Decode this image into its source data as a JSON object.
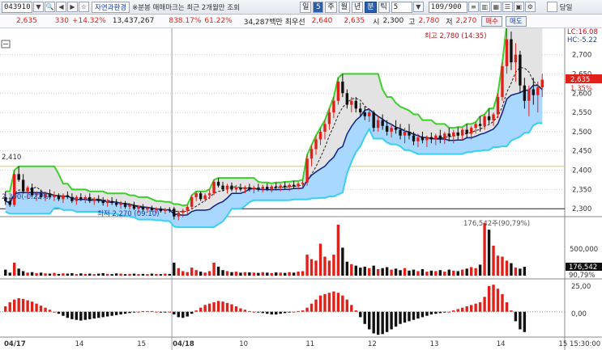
{
  "toolbar": {
    "code": "043910",
    "search_icon": "search-icon",
    "stock_name": "자연과환경",
    "notice": "※분봉 매매마크는 최근 2개월만 조회",
    "periods": [
      "일",
      "5",
      "주",
      "월",
      "년",
      "분",
      "틱"
    ],
    "active_period": "분",
    "interval_value": "5",
    "count_value": "109/900",
    "sameday_label": "당일"
  },
  "quote": {
    "price": "2,635",
    "change": "330",
    "change_pct": "+14.32%",
    "volume": "13,437,267",
    "volume_ratio": "838.17%",
    "turnover": "61.22%",
    "amount": "34,287백만",
    "best_bid_label": "최우선",
    "bid": "2,640",
    "ask": "2,635",
    "open_label": "시",
    "open": "2,300",
    "high_label": "고",
    "high": "2,780",
    "low_label": "저",
    "low": "2,270",
    "buy_label": "매수",
    "sell_label": "매도"
  },
  "colors": {
    "up": "#e0211a",
    "down": "#111111",
    "upper_band": "#3bd12a",
    "lower_band": "#0d1f8a",
    "cloud_light": "#a8d7ff",
    "cloud_dark": "#74b6f2",
    "grid": "#c9ced6",
    "current_price_box": "#e0211a"
  },
  "chart_data": {
    "type": "candlestick",
    "price_axis": {
      "ticks": [
        "2,700",
        "2,650",
        "2,600",
        "2,550",
        "2,500",
        "2,450",
        "2,400",
        "2,350",
        "2,300"
      ],
      "tick_values": [
        2700,
        2650,
        2600,
        2550,
        2500,
        2450,
        2400,
        2350,
        2300
      ],
      "ylim": [
        2290,
        2760
      ],
      "lc_label": "LC:16.08",
      "hc_label": "HC:-5.22",
      "current_price": "2,635",
      "current_pct": "1.35%",
      "left_level": "2,410",
      "prev_close_label": "2,300(-0.22%)"
    },
    "annotations": {
      "high_label": "최고 2,780 (14:35)",
      "low_label": "최저 2,270 (09:10)"
    },
    "time_axis": {
      "labels": [
        "04/17",
        "14",
        "15",
        "04/18",
        "10",
        "11",
        "12",
        "13",
        "14",
        "15",
        "15:30:00"
      ],
      "positions": [
        0,
        16,
        30,
        38,
        53,
        68,
        82,
        96,
        111,
        125,
        133
      ]
    },
    "day_divider_index": 38,
    "candles": [
      [
        2330,
        2345,
        2310,
        2320
      ],
      [
        2320,
        2330,
        2305,
        2310
      ],
      [
        2310,
        2400,
        2305,
        2390
      ],
      [
        2390,
        2410,
        2370,
        2375
      ],
      [
        2375,
        2390,
        2340,
        2345
      ],
      [
        2345,
        2360,
        2325,
        2355
      ],
      [
        2355,
        2365,
        2330,
        2335
      ],
      [
        2335,
        2345,
        2320,
        2340
      ],
      [
        2340,
        2350,
        2325,
        2330
      ],
      [
        2330,
        2345,
        2320,
        2340
      ],
      [
        2340,
        2350,
        2325,
        2330
      ],
      [
        2330,
        2345,
        2320,
        2335
      ],
      [
        2335,
        2340,
        2320,
        2325
      ],
      [
        2325,
        2340,
        2315,
        2335
      ],
      [
        2335,
        2345,
        2325,
        2330
      ],
      [
        2330,
        2340,
        2315,
        2320
      ],
      [
        2320,
        2335,
        2310,
        2330
      ],
      [
        2330,
        2340,
        2320,
        2325
      ],
      [
        2325,
        2335,
        2315,
        2330
      ],
      [
        2330,
        2340,
        2315,
        2320
      ],
      [
        2320,
        2330,
        2310,
        2325
      ],
      [
        2325,
        2335,
        2315,
        2320
      ],
      [
        2320,
        2330,
        2308,
        2315
      ],
      [
        2315,
        2325,
        2305,
        2320
      ],
      [
        2320,
        2330,
        2310,
        2315
      ],
      [
        2315,
        2325,
        2305,
        2310
      ],
      [
        2310,
        2320,
        2300,
        2315
      ],
      [
        2315,
        2320,
        2300,
        2305
      ],
      [
        2305,
        2315,
        2298,
        2310
      ],
      [
        2310,
        2318,
        2296,
        2300
      ],
      [
        2300,
        2310,
        2290,
        2305
      ],
      [
        2305,
        2312,
        2293,
        2298
      ],
      [
        2298,
        2306,
        2290,
        2302
      ],
      [
        2302,
        2308,
        2292,
        2296
      ],
      [
        2296,
        2304,
        2288,
        2300
      ],
      [
        2300,
        2306,
        2290,
        2294
      ],
      [
        2294,
        2302,
        2286,
        2298
      ],
      [
        2298,
        2304,
        2290,
        2295
      ],
      [
        2300,
        2305,
        2272,
        2280
      ],
      [
        2280,
        2295,
        2270,
        2290
      ],
      [
        2290,
        2300,
        2278,
        2295
      ],
      [
        2295,
        2310,
        2285,
        2305
      ],
      [
        2305,
        2335,
        2300,
        2330
      ],
      [
        2330,
        2345,
        2320,
        2340
      ],
      [
        2340,
        2345,
        2320,
        2325
      ],
      [
        2325,
        2340,
        2318,
        2335
      ],
      [
        2335,
        2350,
        2325,
        2340
      ],
      [
        2340,
        2375,
        2335,
        2370
      ],
      [
        2370,
        2380,
        2355,
        2360
      ],
      [
        2360,
        2370,
        2345,
        2350
      ],
      [
        2350,
        2365,
        2340,
        2360
      ],
      [
        2360,
        2368,
        2345,
        2350
      ],
      [
        2350,
        2362,
        2342,
        2355
      ],
      [
        2355,
        2365,
        2345,
        2350
      ],
      [
        2350,
        2360,
        2340,
        2356
      ],
      [
        2356,
        2365,
        2345,
        2350
      ],
      [
        2350,
        2360,
        2340,
        2355
      ],
      [
        2355,
        2365,
        2345,
        2352
      ],
      [
        2352,
        2362,
        2342,
        2357
      ],
      [
        2357,
        2366,
        2346,
        2350
      ],
      [
        2350,
        2362,
        2342,
        2358
      ],
      [
        2358,
        2368,
        2348,
        2355
      ],
      [
        2355,
        2365,
        2345,
        2360
      ],
      [
        2360,
        2370,
        2350,
        2356
      ],
      [
        2356,
        2366,
        2346,
        2362
      ],
      [
        2362,
        2372,
        2352,
        2358
      ],
      [
        2358,
        2370,
        2350,
        2365
      ],
      [
        2365,
        2375,
        2355,
        2368
      ],
      [
        2368,
        2440,
        2360,
        2430
      ],
      [
        2430,
        2465,
        2410,
        2455
      ],
      [
        2455,
        2490,
        2440,
        2480
      ],
      [
        2480,
        2510,
        2465,
        2500
      ],
      [
        2500,
        2530,
        2480,
        2520
      ],
      [
        2520,
        2560,
        2505,
        2550
      ],
      [
        2550,
        2590,
        2535,
        2580
      ],
      [
        2580,
        2640,
        2570,
        2630
      ],
      [
        2630,
        2650,
        2590,
        2600
      ],
      [
        2600,
        2610,
        2560,
        2570
      ],
      [
        2570,
        2590,
        2550,
        2580
      ],
      [
        2580,
        2590,
        2550,
        2560
      ],
      [
        2560,
        2575,
        2540,
        2550
      ],
      [
        2550,
        2565,
        2530,
        2540
      ],
      [
        2540,
        2560,
        2525,
        2550
      ],
      [
        2550,
        2555,
        2500,
        2510
      ],
      [
        2510,
        2540,
        2500,
        2530
      ],
      [
        2530,
        2545,
        2505,
        2515
      ],
      [
        2515,
        2530,
        2490,
        2500
      ],
      [
        2500,
        2520,
        2485,
        2510
      ],
      [
        2510,
        2530,
        2495,
        2505
      ],
      [
        2505,
        2520,
        2480,
        2490
      ],
      [
        2490,
        2510,
        2470,
        2500
      ],
      [
        2500,
        2520,
        2480,
        2490
      ],
      [
        2490,
        2500,
        2465,
        2475
      ],
      [
        2475,
        2495,
        2460,
        2485
      ],
      [
        2485,
        2500,
        2470,
        2478
      ],
      [
        2478,
        2490,
        2460,
        2486
      ],
      [
        2486,
        2498,
        2470,
        2480
      ],
      [
        2480,
        2495,
        2465,
        2490
      ],
      [
        2490,
        2505,
        2470,
        2482
      ],
      [
        2482,
        2500,
        2468,
        2495
      ],
      [
        2495,
        2510,
        2475,
        2488
      ],
      [
        2488,
        2505,
        2470,
        2498
      ],
      [
        2498,
        2512,
        2480,
        2490
      ],
      [
        2490,
        2510,
        2478,
        2505
      ],
      [
        2505,
        2520,
        2485,
        2495
      ],
      [
        2495,
        2515,
        2480,
        2510
      ],
      [
        2510,
        2525,
        2495,
        2520
      ],
      [
        2520,
        2540,
        2500,
        2515
      ],
      [
        2515,
        2545,
        2505,
        2540
      ],
      [
        2540,
        2560,
        2520,
        2530
      ],
      [
        2530,
        2550,
        2515,
        2545
      ],
      [
        2545,
        2600,
        2535,
        2590
      ],
      [
        2590,
        2680,
        2580,
        2670
      ],
      [
        2670,
        2780,
        2650,
        2740
      ],
      [
        2740,
        2760,
        2660,
        2680
      ],
      [
        2680,
        2730,
        2630,
        2700
      ],
      [
        2700,
        2710,
        2600,
        2620
      ],
      [
        2620,
        2640,
        2560,
        2580
      ],
      [
        2580,
        2620,
        2540,
        2610
      ],
      [
        2610,
        2640,
        2570,
        2595
      ],
      [
        2595,
        2630,
        2550,
        2615
      ],
      [
        2615,
        2650,
        2590,
        2635
      ]
    ],
    "volume": {
      "label": "176,542주(90,79%)",
      "tick": "500,000",
      "current": "176,542",
      "current_pct": "90,79%",
      "max": 1100000,
      "values": [
        120000,
        60000,
        260000,
        140000,
        90000,
        60000,
        70000,
        50000,
        60000,
        45000,
        40000,
        55000,
        35000,
        45000,
        40000,
        50000,
        30000,
        45000,
        35000,
        40000,
        30000,
        40000,
        50000,
        35000,
        30000,
        45000,
        40000,
        30000,
        35000,
        40000,
        30000,
        35000,
        30000,
        40000,
        35000,
        30000,
        40000,
        35000,
        260000,
        150000,
        90000,
        70000,
        160000,
        110000,
        80000,
        60000,
        90000,
        260000,
        180000,
        110000,
        90000,
        70000,
        80000,
        60000,
        70000,
        65000,
        60000,
        55000,
        70000,
        60000,
        50000,
        65000,
        60000,
        55000,
        70000,
        60000,
        80000,
        90000,
        420000,
        330000,
        300000,
        640000,
        380000,
        300000,
        420000,
        1020000,
        560000,
        280000,
        230000,
        200000,
        160000,
        180000,
        150000,
        200000,
        130000,
        150000,
        170000,
        120000,
        140000,
        110000,
        150000,
        100000,
        120000,
        90000,
        130000,
        80000,
        100000,
        90000,
        110000,
        80000,
        120000,
        100000,
        90000,
        120000,
        140000,
        170000,
        150000,
        220000,
        1050000,
        920000,
        600000,
        400000,
        380000,
        300000,
        250000,
        160000,
        140000,
        176542
      ]
    },
    "macd": {
      "tick_top": "25,00",
      "tick_mid": "0,00",
      "range": [
        -35,
        45
      ],
      "values": [
        8,
        14,
        18,
        20,
        19,
        17,
        15,
        12,
        9,
        6,
        3,
        0,
        -3,
        -6,
        -9,
        -11,
        -12,
        -13,
        -12,
        -11,
        -10,
        -9,
        -8,
        -7,
        -6,
        -5,
        -4,
        -3,
        -2,
        -1,
        0,
        1,
        1,
        1,
        0,
        -1,
        -1,
        0,
        -4,
        -8,
        -9,
        -7,
        -3,
        2,
        6,
        10,
        12,
        14,
        16,
        15,
        13,
        11,
        8,
        5,
        3,
        1,
        0,
        -1,
        -2,
        -3,
        -4,
        -4,
        -3,
        -2,
        -1,
        0,
        1,
        2,
        6,
        12,
        18,
        24,
        26,
        28,
        30,
        28,
        24,
        18,
        10,
        2,
        -8,
        -18,
        -26,
        -32,
        -34,
        -33,
        -30,
        -26,
        -22,
        -18,
        -16,
        -14,
        -12,
        -10,
        -8,
        -6,
        -4,
        -3,
        -2,
        -1,
        0,
        2,
        4,
        6,
        8,
        10,
        12,
        14,
        22,
        38,
        40,
        34,
        26,
        14,
        2,
        -14,
        -26,
        -30
      ]
    }
  }
}
